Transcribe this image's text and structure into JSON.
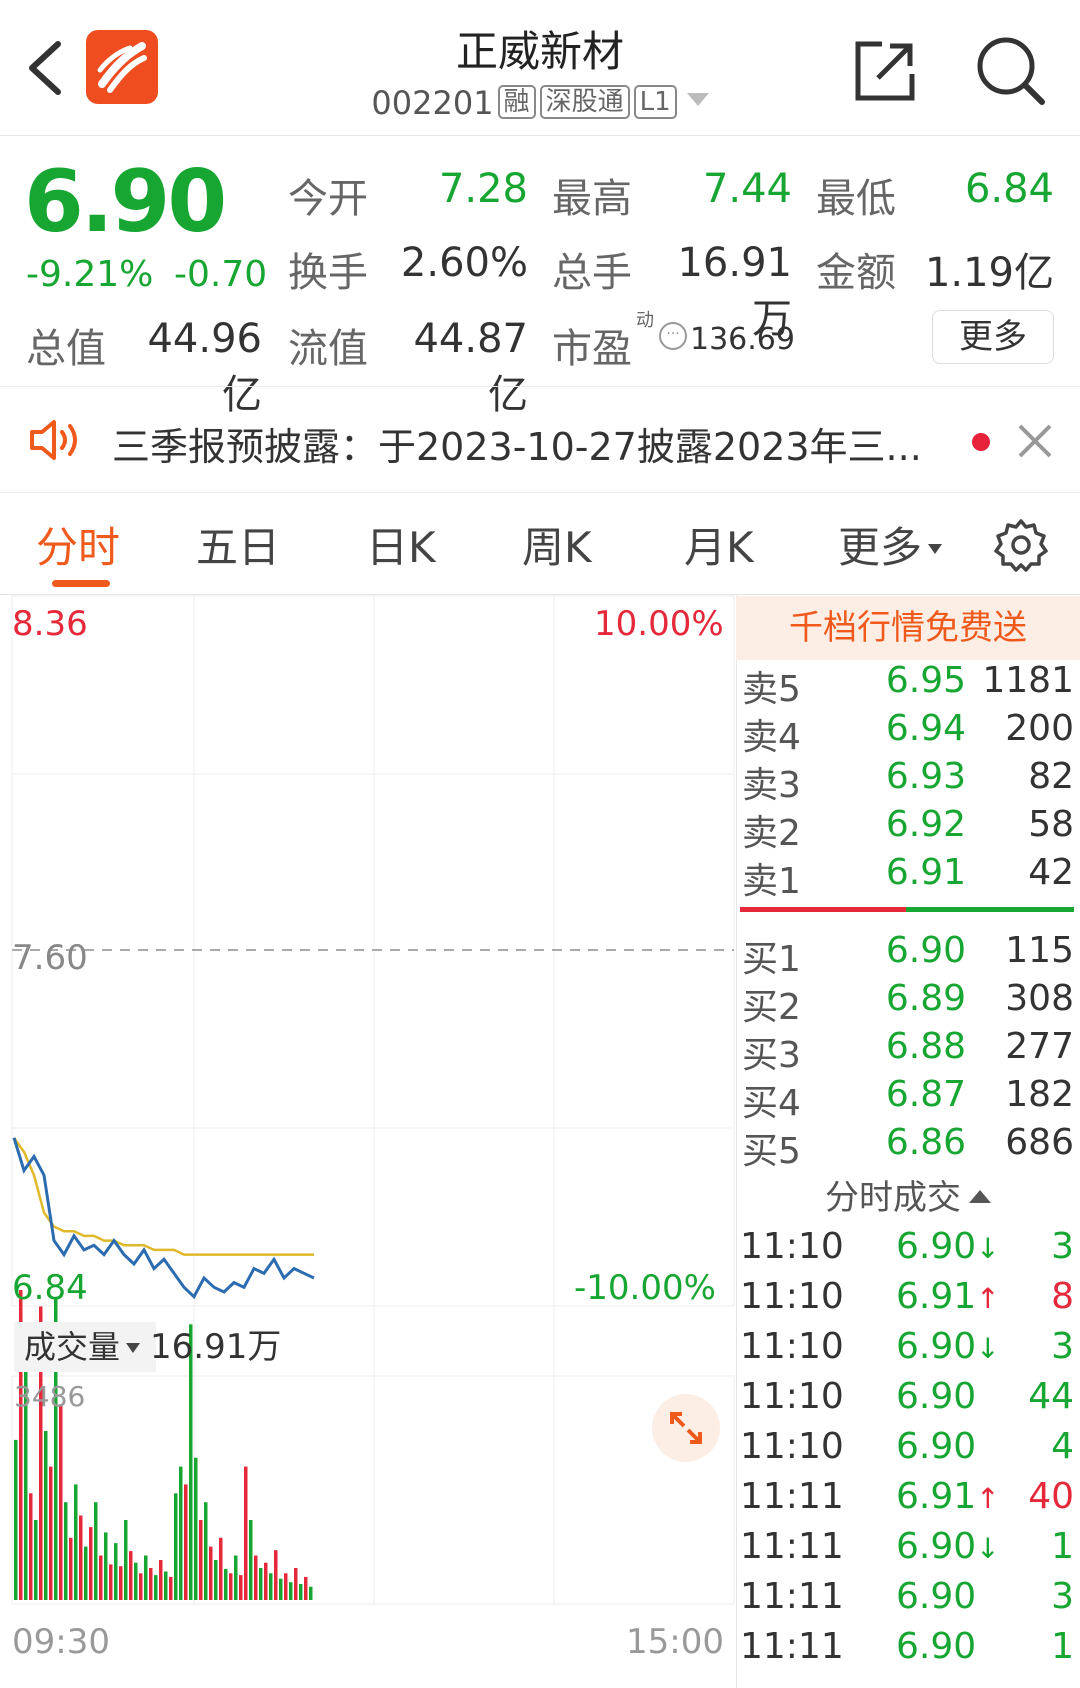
{
  "header": {
    "title": "正威新材",
    "code": "002201",
    "tags": [
      "融",
      "深股通",
      "L1"
    ]
  },
  "quote": {
    "price": "6.90",
    "change_pct": "-9.21%",
    "change_amt": "-0.70",
    "open_label": "今开",
    "open_value": "7.28",
    "high_label": "最高",
    "high_value": "7.44",
    "low_label": "最低",
    "low_value": "6.84",
    "turnover_label": "换手",
    "turnover_value": "2.60%",
    "volume_label": "总手",
    "volume_value": "16.91万",
    "amount_label": "金额",
    "amount_value": "1.19亿",
    "mcap_label": "总值",
    "mcap_value": "44.96亿",
    "float_label": "流值",
    "float_value": "44.87亿",
    "pe_label": "市盈",
    "pe_superscript": "动",
    "pe_value": "136.69",
    "more_button": "更多"
  },
  "notice": {
    "text": "三季报预披露：于2023-10-27披露2023年三..."
  },
  "tabs": [
    "分时",
    "五日",
    "日K",
    "周K",
    "月K",
    "更多"
  ],
  "active_tab": 0,
  "chart": {
    "price_high": "8.36",
    "pct_high": "10.00%",
    "prev_close": "7.60",
    "price_low": "6.84",
    "pct_low": "-10.00%",
    "volume_label": "成交量",
    "volume_total": "16.91万",
    "volume_max": "3486",
    "time_start": "09:30",
    "time_end": "15:00"
  },
  "chart_data": {
    "type": "line",
    "x_range": [
      "09:30",
      "15:00"
    ],
    "ylim": [
      6.84,
      8.36
    ],
    "prev_close": 7.6,
    "series": [
      {
        "values": [
          7.2,
          7.13,
          7.16,
          7.12,
          6.98,
          6.95,
          6.99,
          6.96,
          6.97,
          6.95,
          6.98,
          6.95,
          6.93,
          6.96,
          6.92,
          6.94,
          6.91,
          6.88,
          6.86,
          6.9,
          6.88,
          6.87,
          6.89,
          6.88,
          6.92,
          6.91,
          6.94,
          6.9,
          6.92,
          6.91,
          6.9
        ]
      },
      {
        "values": [
          7.2,
          7.17,
          7.12,
          7.04,
          7.01,
          7.0,
          7.0,
          6.99,
          6.99,
          6.98,
          6.98,
          6.97,
          6.97,
          6.97,
          6.96,
          6.96,
          6.96,
          6.95,
          6.95,
          6.95,
          6.95,
          6.95,
          6.95,
          6.95,
          6.95,
          6.95,
          6.95,
          6.95,
          6.95,
          6.95,
          6.95
        ]
      }
    ],
    "volume": {
      "ylim": [
        0,
        3486
      ],
      "bars": [
        {
          "v": 1800,
          "c": "#17a631"
        },
        {
          "v": 3486,
          "c": "#e5283a"
        },
        {
          "v": 2600,
          "c": "#17a631"
        },
        {
          "v": 1200,
          "c": "#e5283a"
        },
        {
          "v": 900,
          "c": "#17a631"
        },
        {
          "v": 3300,
          "c": "#e5283a"
        },
        {
          "v": 1900,
          "c": "#17a631"
        },
        {
          "v": 1500,
          "c": "#e5283a"
        },
        {
          "v": 3400,
          "c": "#17a631"
        },
        {
          "v": 2200,
          "c": "#e5283a"
        },
        {
          "v": 1100,
          "c": "#17a631"
        },
        {
          "v": 700,
          "c": "#e5283a"
        },
        {
          "v": 1300,
          "c": "#17a631"
        },
        {
          "v": 950,
          "c": "#e5283a"
        },
        {
          "v": 600,
          "c": "#17a631"
        },
        {
          "v": 820,
          "c": "#e5283a"
        },
        {
          "v": 1100,
          "c": "#17a631"
        },
        {
          "v": 500,
          "c": "#e5283a"
        },
        {
          "v": 760,
          "c": "#17a631"
        },
        {
          "v": 400,
          "c": "#e5283a"
        },
        {
          "v": 640,
          "c": "#17a631"
        },
        {
          "v": 380,
          "c": "#e5283a"
        },
        {
          "v": 900,
          "c": "#17a631"
        },
        {
          "v": 550,
          "c": "#e5283a"
        },
        {
          "v": 420,
          "c": "#17a631"
        },
        {
          "v": 300,
          "c": "#e5283a"
        },
        {
          "v": 500,
          "c": "#17a631"
        },
        {
          "v": 360,
          "c": "#e5283a"
        },
        {
          "v": 280,
          "c": "#17a631"
        },
        {
          "v": 450,
          "c": "#e5283a"
        },
        {
          "v": 320,
          "c": "#17a631"
        },
        {
          "v": 260,
          "c": "#e5283a"
        },
        {
          "v": 1200,
          "c": "#17a631"
        },
        {
          "v": 1500,
          "c": "#17a631"
        },
        {
          "v": 1300,
          "c": "#e5283a"
        },
        {
          "v": 3100,
          "c": "#17a631"
        },
        {
          "v": 1600,
          "c": "#17a631"
        },
        {
          "v": 900,
          "c": "#e5283a"
        },
        {
          "v": 1100,
          "c": "#17a631"
        },
        {
          "v": 600,
          "c": "#e5283a"
        },
        {
          "v": 450,
          "c": "#17a631"
        },
        {
          "v": 700,
          "c": "#e5283a"
        },
        {
          "v": 350,
          "c": "#17a631"
        },
        {
          "v": 300,
          "c": "#e5283a"
        },
        {
          "v": 500,
          "c": "#17a631"
        },
        {
          "v": 280,
          "c": "#e5283a"
        },
        {
          "v": 1500,
          "c": "#e5283a"
        },
        {
          "v": 900,
          "c": "#17a631"
        },
        {
          "v": 500,
          "c": "#e5283a"
        },
        {
          "v": 360,
          "c": "#17a631"
        },
        {
          "v": 420,
          "c": "#e5283a"
        },
        {
          "v": 300,
          "c": "#17a631"
        },
        {
          "v": 560,
          "c": "#e5283a"
        },
        {
          "v": 240,
          "c": "#17a631"
        },
        {
          "v": 300,
          "c": "#e5283a"
        },
        {
          "v": 200,
          "c": "#17a631"
        },
        {
          "v": 360,
          "c": "#e5283a"
        },
        {
          "v": 180,
          "c": "#17a631"
        },
        {
          "v": 260,
          "c": "#e5283a"
        },
        {
          "v": 150,
          "c": "#17a631"
        }
      ]
    }
  },
  "orderbook": {
    "promo": "千档行情免费送",
    "asks": [
      {
        "label": "卖5",
        "price": "6.95",
        "qty": "1181"
      },
      {
        "label": "卖4",
        "price": "6.94",
        "qty": "200"
      },
      {
        "label": "卖3",
        "price": "6.93",
        "qty": "82"
      },
      {
        "label": "卖2",
        "price": "6.92",
        "qty": "58"
      },
      {
        "label": "卖1",
        "price": "6.91",
        "qty": "42"
      }
    ],
    "bids": [
      {
        "label": "买1",
        "price": "6.90",
        "qty": "115"
      },
      {
        "label": "买2",
        "price": "6.89",
        "qty": "308"
      },
      {
        "label": "买3",
        "price": "6.88",
        "qty": "277"
      },
      {
        "label": "买4",
        "price": "6.87",
        "qty": "182"
      },
      {
        "label": "买5",
        "price": "6.86",
        "qty": "686"
      }
    ]
  },
  "ticks": {
    "header": "分时成交",
    "rows": [
      {
        "time": "11:10",
        "price": "6.90",
        "dir": "↓",
        "vol": "3",
        "color": "#17a631"
      },
      {
        "time": "11:10",
        "price": "6.91",
        "dir": "↑",
        "vol": "8",
        "color": "#e5283a"
      },
      {
        "time": "11:10",
        "price": "6.90",
        "dir": "↓",
        "vol": "3",
        "color": "#17a631"
      },
      {
        "time": "11:10",
        "price": "6.90",
        "dir": "",
        "vol": "44",
        "color": "#17a631"
      },
      {
        "time": "11:10",
        "price": "6.90",
        "dir": "",
        "vol": "4",
        "color": "#17a631"
      },
      {
        "time": "11:11",
        "price": "6.91",
        "dir": "↑",
        "vol": "40",
        "color": "#e5283a"
      },
      {
        "time": "11:11",
        "price": "6.90",
        "dir": "↓",
        "vol": "1",
        "color": "#17a631"
      },
      {
        "time": "11:11",
        "price": "6.90",
        "dir": "",
        "vol": "3",
        "color": "#17a631"
      },
      {
        "time": "11:11",
        "price": "6.90",
        "dir": "",
        "vol": "1",
        "color": "#17a631"
      }
    ]
  },
  "colors": {
    "up": "#e5283a",
    "down": "#17a631",
    "accent": "#ef5a1c",
    "price_line": "#2b6cb0",
    "avg_line": "#e0b92a"
  }
}
